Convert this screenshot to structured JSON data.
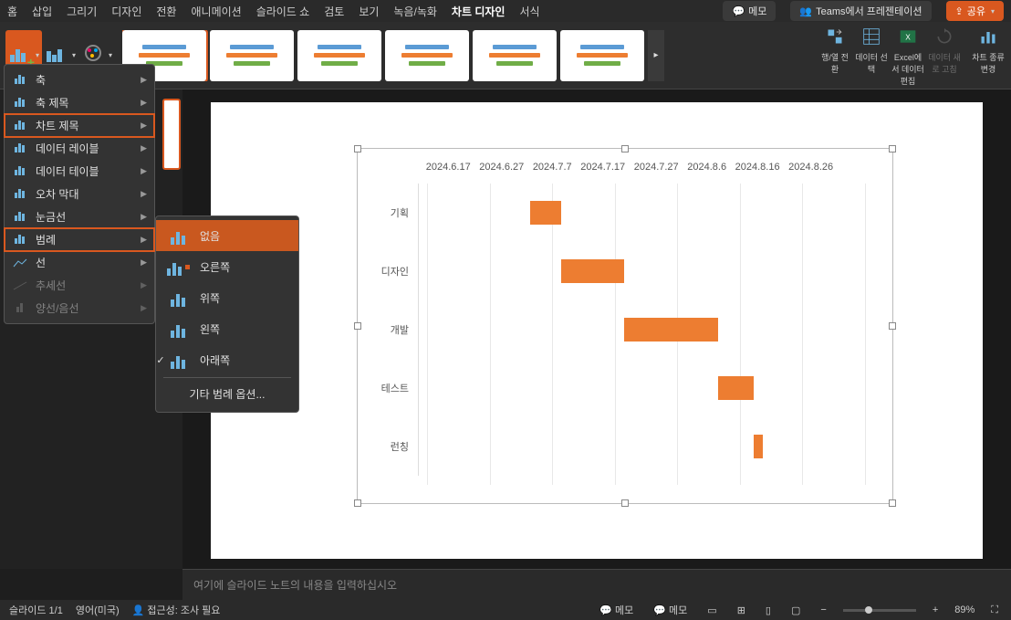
{
  "menubar": {
    "items": [
      "홈",
      "삽입",
      "그리기",
      "디자인",
      "전환",
      "애니메이션",
      "슬라이드 쇼",
      "검토",
      "보기",
      "녹음/녹화",
      "차트 디자인",
      "서식"
    ],
    "active_index": 10,
    "memo": "메모",
    "teams": "Teams에서 프레젠테이션",
    "share": "공유"
  },
  "ribbon": {
    "tools": {
      "switch_rc": "행/열 전환",
      "select_data": "데이터 선택",
      "edit_excel": "Excel에서 데이터 편집",
      "refresh": "데이터 새로 고침",
      "chart_type": "차트 종류 변경"
    }
  },
  "dropdown1": {
    "items": [
      {
        "label": "축",
        "disabled": false
      },
      {
        "label": "축 제목",
        "disabled": false
      },
      {
        "label": "차트 제목",
        "disabled": false,
        "hl": true
      },
      {
        "label": "데이터 레이블",
        "disabled": false
      },
      {
        "label": "데이터 테이블",
        "disabled": false
      },
      {
        "label": "오차 막대",
        "disabled": false
      },
      {
        "label": "눈금선",
        "disabled": false
      },
      {
        "label": "범례",
        "disabled": false,
        "hl": true
      },
      {
        "label": "선",
        "disabled": false
      },
      {
        "label": "추세선",
        "disabled": true
      },
      {
        "label": "양선/음선",
        "disabled": true
      }
    ]
  },
  "dropdown2": {
    "items": [
      {
        "label": "없음",
        "selected": true
      },
      {
        "label": "오른쪽"
      },
      {
        "label": "위쪽"
      },
      {
        "label": "왼쪽"
      },
      {
        "label": "아래쪽",
        "checked": true
      }
    ],
    "more": "기타 범례 옵션..."
  },
  "chart_data": {
    "type": "bar",
    "orientation": "horizontal-gantt",
    "x_labels": [
      "2024.6.17",
      "2024.6.27",
      "2024.7.7",
      "2024.7.17",
      "2024.7.27",
      "2024.8.6",
      "2024.8.16",
      "2024.8.26"
    ],
    "categories": [
      "기획",
      "디자인",
      "개발",
      "테스트",
      "런칭"
    ],
    "bars": [
      {
        "category": "기획",
        "start_pct": 25,
        "width_pct": 7
      },
      {
        "category": "디자인",
        "start_pct": 32,
        "width_pct": 14
      },
      {
        "category": "개발",
        "start_pct": 46,
        "width_pct": 21
      },
      {
        "category": "테스트",
        "start_pct": 67,
        "width_pct": 8
      },
      {
        "category": "런칭",
        "start_pct": 75,
        "width_pct": 2
      }
    ],
    "bar_color": "#ed7d31"
  },
  "notes": {
    "placeholder": "여기에 슬라이드 노트의 내용을 입력하십시오"
  },
  "statusbar": {
    "slide": "슬라이드 1/1",
    "lang": "영어(미국)",
    "a11y": "접근성: 조사 필요",
    "memo1": "메모",
    "memo2": "메모",
    "zoom": "89%"
  }
}
